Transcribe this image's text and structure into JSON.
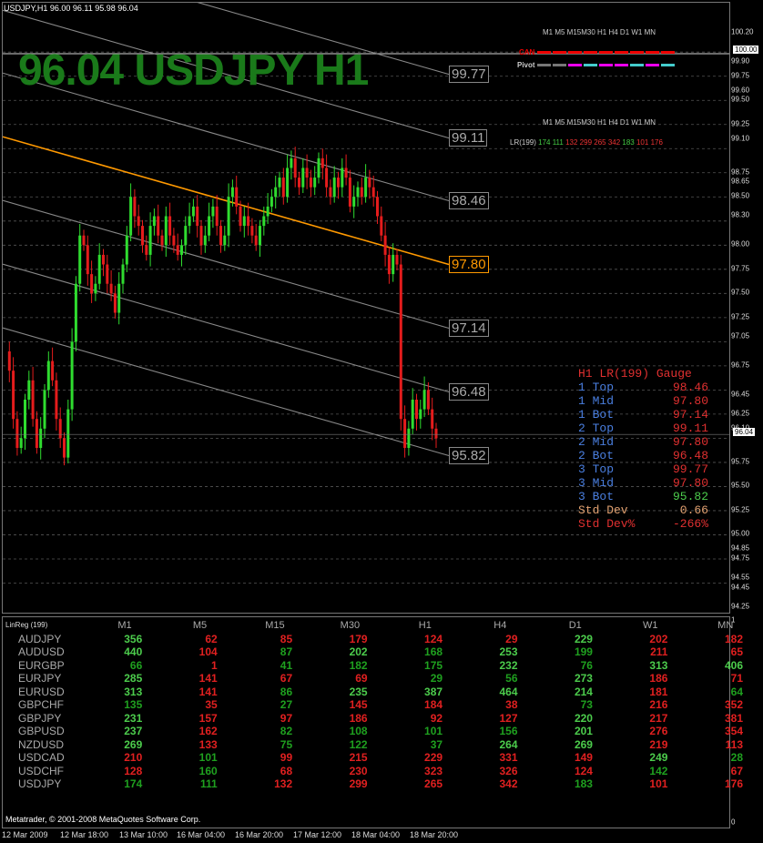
{
  "header": {
    "symbol_info": "USDJPY,H1  96.00 96.11 95.98 96.04"
  },
  "title": "96.04 USDJPY H1",
  "channel_labels": [
    "99.77",
    "99.11",
    "98.46",
    "97.80",
    "97.14",
    "96.48",
    "95.82"
  ],
  "y_axis": [
    "100.20",
    "99.90",
    "99.75",
    "99.60",
    "99.50",
    "99.25",
    "99.10",
    "98.75",
    "98.65",
    "98.50",
    "98.30",
    "98.00",
    "97.75",
    "97.50",
    "97.25",
    "97.05",
    "96.75",
    "96.45",
    "96.25",
    "96.10",
    "95.75",
    "95.50",
    "95.25",
    "95.00",
    "94.85",
    "94.75",
    "94.55",
    "94.45",
    "94.25"
  ],
  "current_price": "96.04",
  "top_price": "100.00",
  "x_axis": [
    "12 Mar 2009",
    "12 Mar 18:00",
    "13 Mar 10:00",
    "16 Mar 04:00",
    "16 Mar 20:00",
    "17 Mar 12:00",
    "18 Mar 04:00",
    "18 Mar 20:00"
  ],
  "tf_header": "M1  M5  M15M30   H1   H4   D1   W1  MN",
  "tf_rows": [
    {
      "label": "CAN",
      "colors": [
        "#e00",
        "#e00",
        "#e00",
        "#e00",
        "#e00",
        "#e00",
        "#e00",
        "#e00",
        "#e00"
      ]
    },
    {
      "label": "Pivot",
      "colors": [
        "#777",
        "#777",
        "#e0e",
        "#4cc",
        "#e0e",
        "#e0e",
        "#4cc",
        "#e0e",
        "#4cc"
      ]
    }
  ],
  "lr_header": "M1  M5  M15M30   H1   H4   D1   W1  MN",
  "lr_row": {
    "label": "LR(199)",
    "values": [
      {
        "v": "174",
        "c": "#4c4"
      },
      {
        "v": "111",
        "c": "#4c4"
      },
      {
        "v": "132",
        "c": "#e33"
      },
      {
        "v": "299",
        "c": "#e33"
      },
      {
        "v": "265",
        "c": "#e33"
      },
      {
        "v": "342",
        "c": "#e33"
      },
      {
        "v": "183",
        "c": "#4c4"
      },
      {
        "v": "101",
        "c": "#e33"
      },
      {
        "v": "176",
        "c": "#e33"
      }
    ]
  },
  "gauge": {
    "title": "H1 LR(199) Gauge",
    "rows": [
      {
        "k": "1 Top",
        "v": "98.46"
      },
      {
        "k": "1 Mid",
        "v": "97.80"
      },
      {
        "k": "1 Bot",
        "v": "97.14"
      },
      {
        "k": "2 Top",
        "v": "99.11"
      },
      {
        "k": "2 Mid",
        "v": "97.80"
      },
      {
        "k": "2 Bot",
        "v": "96.48"
      },
      {
        "k": "3 Top",
        "v": "99.77"
      },
      {
        "k": "3 Mid",
        "v": "97.80"
      },
      {
        "k": "3 Bot",
        "v": "95.82"
      },
      {
        "k": "Std Dev",
        "v": "0.66"
      },
      {
        "k": "Std Dev%",
        "v": "-266%"
      }
    ]
  },
  "linreg": {
    "label": "LinReg (199)",
    "columns": [
      "M1",
      "M5",
      "M15",
      "M30",
      "H1",
      "H4",
      "D1",
      "W1",
      "MN"
    ],
    "rows": [
      {
        "sym": "AUDJPY",
        "cells": [
          [
            "356",
            "g"
          ],
          [
            "62",
            "r"
          ],
          [
            "85",
            "r"
          ],
          [
            "179",
            "r"
          ],
          [
            "124",
            "r"
          ],
          [
            "29",
            "r"
          ],
          [
            "229",
            "g"
          ],
          [
            "202",
            "r"
          ],
          [
            "182",
            "r"
          ]
        ]
      },
      {
        "sym": "AUDUSD",
        "cells": [
          [
            "440",
            "g"
          ],
          [
            "104",
            "r"
          ],
          [
            "87",
            "dg"
          ],
          [
            "202",
            "g"
          ],
          [
            "168",
            "dg"
          ],
          [
            "253",
            "g"
          ],
          [
            "199",
            "dg"
          ],
          [
            "211",
            "r"
          ],
          [
            "65",
            "r"
          ]
        ]
      },
      {
        "sym": "EURGBP",
        "cells": [
          [
            "66",
            "dg"
          ],
          [
            "1",
            "r"
          ],
          [
            "41",
            "dg"
          ],
          [
            "182",
            "dg"
          ],
          [
            "175",
            "dg"
          ],
          [
            "232",
            "g"
          ],
          [
            "76",
            "dg"
          ],
          [
            "313",
            "g"
          ],
          [
            "406",
            "g"
          ]
        ]
      },
      {
        "sym": "EURJPY",
        "cells": [
          [
            "285",
            "g"
          ],
          [
            "141",
            "r"
          ],
          [
            "67",
            "r"
          ],
          [
            "69",
            "r"
          ],
          [
            "29",
            "dg"
          ],
          [
            "56",
            "dg"
          ],
          [
            "273",
            "g"
          ],
          [
            "186",
            "r"
          ],
          [
            "71",
            "r"
          ]
        ]
      },
      {
        "sym": "EURUSD",
        "cells": [
          [
            "313",
            "g"
          ],
          [
            "141",
            "r"
          ],
          [
            "86",
            "dg"
          ],
          [
            "235",
            "g"
          ],
          [
            "387",
            "g"
          ],
          [
            "464",
            "g"
          ],
          [
            "214",
            "g"
          ],
          [
            "181",
            "r"
          ],
          [
            "64",
            "dg"
          ]
        ]
      },
      {
        "sym": "GBPCHF",
        "cells": [
          [
            "135",
            "dg"
          ],
          [
            "35",
            "r"
          ],
          [
            "27",
            "dg"
          ],
          [
            "145",
            "r"
          ],
          [
            "184",
            "r"
          ],
          [
            "38",
            "r"
          ],
          [
            "73",
            "dg"
          ],
          [
            "216",
            "r"
          ],
          [
            "352",
            "r"
          ]
        ]
      },
      {
        "sym": "GBPJPY",
        "cells": [
          [
            "231",
            "g"
          ],
          [
            "157",
            "r"
          ],
          [
            "97",
            "r"
          ],
          [
            "186",
            "r"
          ],
          [
            "92",
            "r"
          ],
          [
            "127",
            "r"
          ],
          [
            "220",
            "g"
          ],
          [
            "217",
            "r"
          ],
          [
            "381",
            "r"
          ]
        ]
      },
      {
        "sym": "GBPUSD",
        "cells": [
          [
            "237",
            "g"
          ],
          [
            "162",
            "r"
          ],
          [
            "82",
            "dg"
          ],
          [
            "108",
            "dg"
          ],
          [
            "101",
            "dg"
          ],
          [
            "156",
            "dg"
          ],
          [
            "201",
            "g"
          ],
          [
            "276",
            "r"
          ],
          [
            "354",
            "r"
          ]
        ]
      },
      {
        "sym": "NZDUSD",
        "cells": [
          [
            "269",
            "g"
          ],
          [
            "133",
            "r"
          ],
          [
            "75",
            "dg"
          ],
          [
            "122",
            "dg"
          ],
          [
            "37",
            "dg"
          ],
          [
            "264",
            "g"
          ],
          [
            "269",
            "g"
          ],
          [
            "219",
            "r"
          ],
          [
            "113",
            "r"
          ]
        ]
      },
      {
        "sym": "USDCAD",
        "cells": [
          [
            "210",
            "r"
          ],
          [
            "101",
            "dg"
          ],
          [
            "99",
            "r"
          ],
          [
            "215",
            "r"
          ],
          [
            "229",
            "r"
          ],
          [
            "331",
            "r"
          ],
          [
            "149",
            "r"
          ],
          [
            "249",
            "g"
          ],
          [
            "28",
            "dg"
          ]
        ]
      },
      {
        "sym": "USDCHF",
        "cells": [
          [
            "128",
            "r"
          ],
          [
            "160",
            "dg"
          ],
          [
            "68",
            "r"
          ],
          [
            "230",
            "r"
          ],
          [
            "323",
            "r"
          ],
          [
            "326",
            "r"
          ],
          [
            "124",
            "r"
          ],
          [
            "142",
            "dg"
          ],
          [
            "67",
            "r"
          ]
        ]
      },
      {
        "sym": "USDJPY",
        "cells": [
          [
            "174",
            "dg"
          ],
          [
            "111",
            "dg"
          ],
          [
            "132",
            "r"
          ],
          [
            "299",
            "r"
          ],
          [
            "265",
            "r"
          ],
          [
            "342",
            "r"
          ],
          [
            "183",
            "dg"
          ],
          [
            "101",
            "r"
          ],
          [
            "176",
            "r"
          ]
        ]
      }
    ]
  },
  "sub_axis": {
    "top": "1",
    "bottom": "0"
  },
  "footer": "Metatrader, © 2001-2008 MetaQuotes Software Corp.",
  "colors": {
    "green": "#4ccc4c",
    "darkgreen": "#1fa01f",
    "red": "#e02020",
    "gauge_blue": "#4a7fe0",
    "gauge_red": "#e03030",
    "orange": "#ff9900"
  }
}
